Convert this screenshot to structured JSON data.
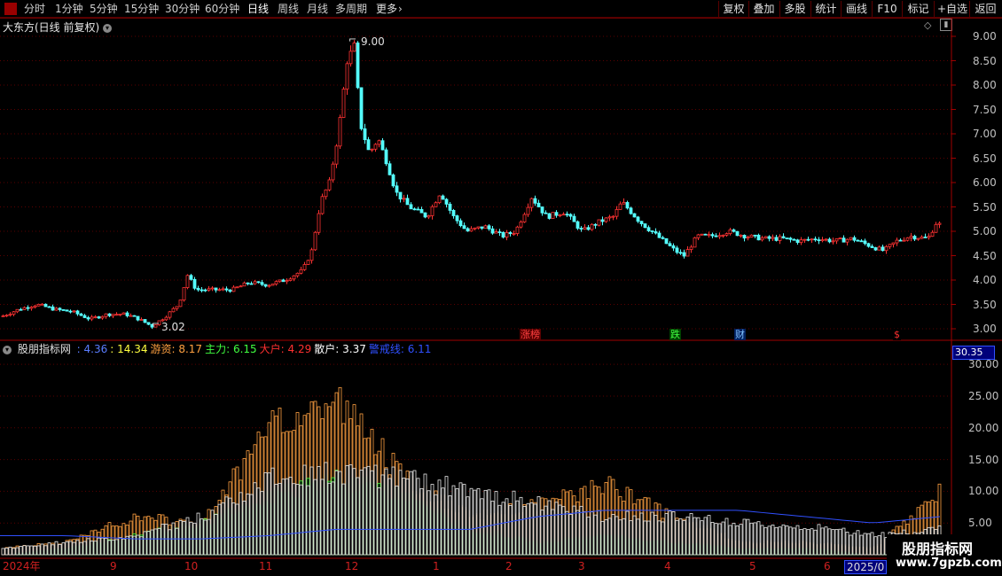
{
  "toolbar": {
    "periods": [
      "分时",
      "1分钟",
      "5分钟",
      "15分钟",
      "30分钟",
      "60分钟",
      "日线",
      "周线",
      "月线",
      "多周期",
      "更多"
    ],
    "active_period": "日线",
    "buttons": [
      "复权",
      "叠加",
      "多股",
      "统计",
      "画线",
      "F10",
      "标记",
      "+自选",
      "返回"
    ]
  },
  "main": {
    "title": "大东方(日线 前复权)",
    "high_label": "9.00",
    "low_label": "3.02",
    "events": [
      {
        "label": "涨榜",
        "color": "#ff4040",
        "bg": "#5a0000"
      },
      {
        "label": "跌",
        "color": "#40ff40",
        "bg": "#004000"
      },
      {
        "label": "财",
        "color": "#80c0ff",
        "bg": "#002060"
      },
      {
        "label": "$",
        "color": "#ff3030",
        "bg": "#000000"
      }
    ],
    "price_ticks": [
      "9.00",
      "8.50",
      "8.00",
      "7.50",
      "7.00",
      "6.50",
      "6.00",
      "5.50",
      "5.00",
      "4.50",
      "4.00",
      "3.50",
      "3.00"
    ]
  },
  "indicator": {
    "name": "股朋指标网",
    "values": [
      {
        "label": "",
        "value": "4.36",
        "color": "#5a7dff"
      },
      {
        "label": "",
        "value": "14.34",
        "color": "#ffff40"
      },
      {
        "label": "游资",
        "value": "8.17",
        "color": "#ffa040"
      },
      {
        "label": "主力",
        "value": "6.15",
        "color": "#40ff40"
      },
      {
        "label": "大户",
        "value": "4.29",
        "color": "#ff3030"
      },
      {
        "label": "散户",
        "value": "3.37",
        "color": "#ffffff"
      },
      {
        "label": "警戒线",
        "value": "6.11",
        "color": "#3050ff"
      }
    ],
    "readout": "30.35",
    "ticks": [
      "30.00",
      "25.00",
      "20.00",
      "15.00",
      "10.00",
      "5.00"
    ]
  },
  "months": [
    "2024年",
    "9",
    "10",
    "11",
    "12",
    "1",
    "2",
    "3",
    "4",
    "5",
    "6",
    "2025/0"
  ],
  "watermark": {
    "title": "股朋指标网",
    "url": "www.7gpzb.com"
  },
  "chart_data": {
    "type": "candlestick",
    "title": "大东方(日线 前复权)",
    "ylim": [
      2.8,
      9.2
    ],
    "price_high": 9.0,
    "price_low": 3.02,
    "x_months": [
      "2024年",
      "9",
      "10",
      "11",
      "12",
      "1",
      "2",
      "3",
      "4",
      "5",
      "6",
      "2025/0"
    ],
    "close_path": [
      [
        0,
        3.25
      ],
      [
        20,
        3.4
      ],
      [
        40,
        3.5
      ],
      [
        60,
        3.4
      ],
      [
        80,
        3.35
      ],
      [
        100,
        3.2
      ],
      [
        120,
        3.3
      ],
      [
        140,
        3.3
      ],
      [
        155,
        3.2
      ],
      [
        170,
        3.05
      ],
      [
        185,
        3.25
      ],
      [
        200,
        3.5
      ],
      [
        210,
        4.1
      ],
      [
        220,
        3.8
      ],
      [
        240,
        3.8
      ],
      [
        260,
        3.8
      ],
      [
        280,
        3.95
      ],
      [
        300,
        3.9
      ],
      [
        320,
        4.0
      ],
      [
        340,
        4.2
      ],
      [
        350,
        4.6
      ],
      [
        360,
        5.6
      ],
      [
        370,
        6.0
      ],
      [
        380,
        7.0
      ],
      [
        390,
        8.5
      ],
      [
        398,
        8.8
      ],
      [
        405,
        7.2
      ],
      [
        415,
        6.6
      ],
      [
        425,
        6.9
      ],
      [
        435,
        6.4
      ],
      [
        445,
        5.8
      ],
      [
        460,
        5.5
      ],
      [
        480,
        5.3
      ],
      [
        495,
        5.8
      ],
      [
        510,
        5.3
      ],
      [
        525,
        5.0
      ],
      [
        545,
        5.1
      ],
      [
        565,
        4.9
      ],
      [
        580,
        5.0
      ],
      [
        598,
        5.7
      ],
      [
        615,
        5.3
      ],
      [
        635,
        5.4
      ],
      [
        655,
        5.0
      ],
      [
        675,
        5.2
      ],
      [
        690,
        5.3
      ],
      [
        700,
        5.6
      ],
      [
        720,
        5.2
      ],
      [
        740,
        4.9
      ],
      [
        760,
        4.6
      ],
      [
        770,
        4.5
      ],
      [
        785,
        4.9
      ],
      [
        800,
        4.9
      ],
      [
        820,
        5.0
      ],
      [
        840,
        4.9
      ],
      [
        860,
        4.85
      ],
      [
        880,
        4.85
      ],
      [
        900,
        4.8
      ],
      [
        920,
        4.85
      ],
      [
        940,
        4.8
      ],
      [
        960,
        4.85
      ],
      [
        980,
        4.7
      ],
      [
        995,
        4.6
      ],
      [
        1010,
        4.8
      ],
      [
        1025,
        4.9
      ],
      [
        1045,
        4.85
      ],
      [
        1055,
        5.2
      ],
      [
        1060,
        5.1
      ]
    ],
    "ind_ylim": [
      0,
      31
    ],
    "series": [
      {
        "name": "散户",
        "color": "#ffffff",
        "values": [
          1,
          2,
          3,
          6,
          12,
          13,
          12,
          10,
          8,
          6,
          6,
          5,
          4.5,
          3,
          4
        ]
      },
      {
        "name": "大户",
        "color": "#ff3030",
        "values": [
          0,
          1,
          2,
          4,
          6,
          10,
          8,
          3,
          1,
          1,
          1,
          0,
          0,
          0,
          1
        ]
      },
      {
        "name": "主力",
        "color": "#40ff40",
        "values": [
          0,
          1,
          3,
          5,
          9,
          12,
          9,
          4,
          2,
          3,
          2,
          1,
          1,
          0,
          2
        ]
      },
      {
        "name": "游资",
        "color": "#ffa040",
        "values": [
          1,
          2,
          6,
          5,
          20,
          25,
          12,
          6,
          8,
          11,
          6,
          2,
          2,
          1,
          10
        ]
      },
      {
        "name": "警戒线",
        "color": "#3050ff",
        "values": [
          3,
          3,
          2.5,
          2.5,
          3,
          4,
          4,
          4,
          6,
          7,
          7,
          7,
          6,
          5,
          6
        ]
      }
    ]
  }
}
